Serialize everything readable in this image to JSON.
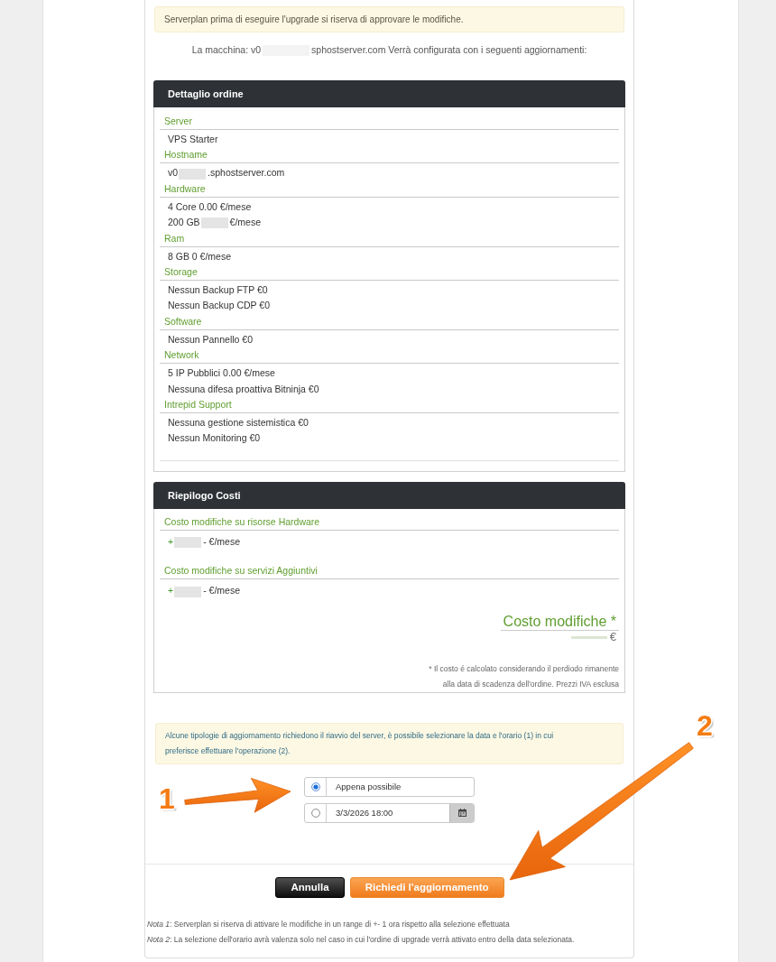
{
  "notice": {
    "text": "Serverplan prima di eseguire l'upgrade si riserva di approvare le modifiche."
  },
  "machine_line": [
    {
      "kind": "text",
      "text": "La macchina: v0"
    },
    {
      "kind": "redacted"
    },
    {
      "kind": "text",
      "text": "sphostserver.com Verrà configurata con i seguenti aggiornamenti:"
    }
  ],
  "order_detail": {
    "title": "Dettaglio ordine",
    "groups": [
      {
        "label": "Server",
        "lines": [
          [
            {
              "kind": "text",
              "text": "VPS Starter"
            }
          ]
        ]
      },
      {
        "label": "Hostname",
        "lines": [
          [
            {
              "kind": "text",
              "text": "v0"
            },
            {
              "kind": "redacted"
            },
            {
              "kind": "text",
              "text": ".sphostserver.com"
            }
          ]
        ]
      },
      {
        "label": "Hardware",
        "lines": [
          [
            {
              "kind": "text",
              "text": "4 Core 0.00 €/mese"
            }
          ],
          [
            {
              "kind": "text",
              "text": "200 GB"
            },
            {
              "kind": "redacted"
            },
            {
              "kind": "text",
              "text": "€/mese"
            }
          ]
        ]
      },
      {
        "label": "Ram",
        "lines": [
          [
            {
              "kind": "text",
              "text": "8 GB 0 €/mese"
            }
          ]
        ]
      },
      {
        "label": "Storage",
        "lines": [
          [
            {
              "kind": "text",
              "text": "Nessun Backup FTP €0"
            }
          ],
          [
            {
              "kind": "text",
              "text": "Nessun Backup CDP €0"
            }
          ]
        ]
      },
      {
        "label": "Software",
        "lines": [
          [
            {
              "kind": "text",
              "text": "Nessun Pannello €0"
            }
          ]
        ]
      },
      {
        "label": "Network",
        "lines": [
          [
            {
              "kind": "text",
              "text": "5 IP Pubblici 0.00 €/mese"
            }
          ],
          [
            {
              "kind": "text",
              "text": "Nessuna difesa proattiva Bitninja €0"
            }
          ]
        ]
      },
      {
        "label": "Intrepid Support",
        "lines": [
          [
            {
              "kind": "text",
              "text": "Nessuna gestione sistemistica €0"
            }
          ],
          [
            {
              "kind": "text",
              "text": "Nessun Monitoring €0"
            }
          ]
        ]
      }
    ]
  },
  "cost_summary": {
    "title": "Riepilogo Costi",
    "groups": [
      {
        "label": "Costo modifiche su risorse Hardware",
        "lines": [
          [
            {
              "kind": "accent",
              "text": "+"
            },
            {
              "kind": "redacted"
            },
            {
              "kind": "text",
              "text": "- €/mese"
            }
          ]
        ]
      },
      {
        "label": "Costo modifiche su servizi Aggiuntivi",
        "lines": [
          [
            {
              "kind": "accent",
              "text": "+"
            },
            {
              "kind": "redacted"
            },
            {
              "kind": "text",
              "text": "- €/mese"
            }
          ]
        ]
      }
    ],
    "total": {
      "label": "Costo modifiche *",
      "value": [
        {
          "kind": "redacted"
        },
        {
          "kind": "text",
          "text": "€"
        }
      ]
    },
    "footnote": "* Il costo é calcolato considerando il perdiodo rimanente alla data di scadenza dell'ordine. Prezzi IVA esclusa"
  },
  "reboot_notice": {
    "text": "Alcune tipologie di aggiornamento richiedono il riavvio del server, è possibile selezionare la data e l'orario (1) in cui preferisce effettuare l'operazione (2)."
  },
  "schedule": {
    "options": [
      {
        "kind": "text",
        "label": "Appena possibile",
        "selected": true
      },
      {
        "kind": "date",
        "value": "3/3/2026 18:00",
        "selected": false
      }
    ]
  },
  "buttons": [
    {
      "kind": "secondary",
      "label": "Annulla"
    },
    {
      "kind": "primary",
      "label": "Richiedi l'aggiornamento"
    }
  ],
  "notes": [
    "*Nota 1*: Serverplan si riserva di attivare le modifiche in un range di +- 1 ora rispetto alla selezione effettuata",
    "*Nota 2*: La selezione dell'orario avrà valenza solo nel caso in cui l'ordine di upgrade verrà attivato entro della data selezionata."
  ],
  "annotations": [
    {
      "label": "1"
    },
    {
      "label": "2"
    }
  ]
}
